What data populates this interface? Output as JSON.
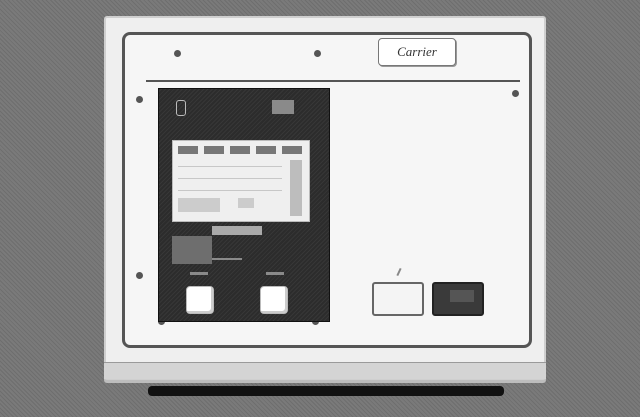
{
  "brand_badge": {
    "text": "Carrier"
  },
  "colors": {
    "panel": "#f6f6f6",
    "module": "#2c2c2c",
    "background": "#7a7a7a"
  }
}
